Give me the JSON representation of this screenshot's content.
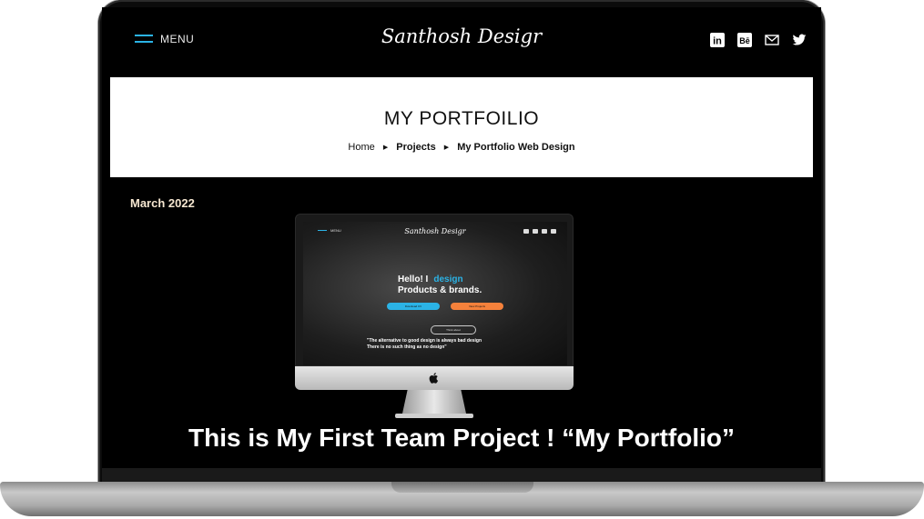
{
  "header": {
    "menu_label": "MENU",
    "logo": "Santhosh Desigr",
    "social": [
      "linkedin-icon",
      "behance-icon",
      "mail-icon",
      "twitter-icon"
    ],
    "behance_text": "Bē",
    "linkedin_text": "in"
  },
  "title_band": {
    "title": "MY PORTFOILIO",
    "breadcrumb": [
      "Home",
      "Projects",
      "My Portfolio Web Design"
    ]
  },
  "date": "March 2022",
  "mockup": {
    "menu_label": "MENU",
    "logo": "Santhosh Desigr",
    "hero_line1": "Hello! I",
    "hero_highlight": "design",
    "hero_line2": "Products & brands.",
    "btn_cv": "Download CV",
    "btn_projects": "View Projects",
    "think_label": "Think about",
    "quote_line1": "\"The alternative to good design is always bad design",
    "quote_line2": "There is no such thing as no design\""
  },
  "headline": "This is My First Team Project ! “My Portfolio”",
  "colors": {
    "accent": "#2bb3e6",
    "orange": "#f5813b",
    "date": "#f5e6d0"
  }
}
